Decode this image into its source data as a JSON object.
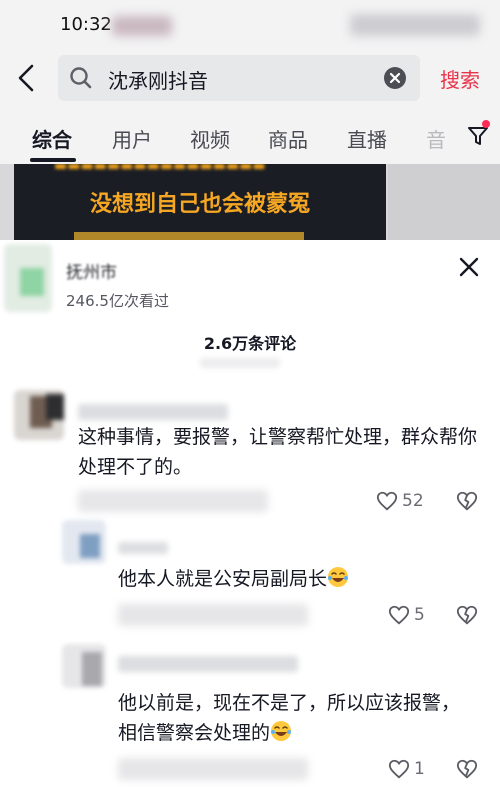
{
  "status_bar": {
    "time": "10:32"
  },
  "search": {
    "query": "沈承刚抖音",
    "submit_label": "搜索"
  },
  "tabs": [
    {
      "label": "综合",
      "active": true
    },
    {
      "label": "用户",
      "active": false
    },
    {
      "label": "视频",
      "active": false
    },
    {
      "label": "商品",
      "active": false
    },
    {
      "label": "直播",
      "active": false
    },
    {
      "label": "音",
      "active": false
    }
  ],
  "video": {
    "caption": "没想到自己也会被蒙冤"
  },
  "sheet": {
    "account_name": "抚州市",
    "views": "246.5亿次看过",
    "comment_count": "2.6万条评论"
  },
  "comments": [
    {
      "text": "这种事情，要报警，让警察帮忙处理，群众帮你处理不了的。",
      "likes": "52"
    },
    {
      "text": "他本人就是公安局副局长",
      "likes": "5",
      "emoji": "laughing-crying"
    },
    {
      "text": "他以前是，现在不是了，所以应该报警，相信警察会处理的",
      "likes": "1",
      "emoji": "laughing-crying"
    }
  ],
  "colors": {
    "accent_red": "#e8334a",
    "text_primary": "#161823",
    "text_secondary": "#6b6c73",
    "caption_orange": "#f5a623"
  },
  "icons": [
    "back-arrow-icon",
    "search-icon",
    "clear-icon",
    "filter-icon",
    "close-icon",
    "heart-icon",
    "broken-heart-icon",
    "laughing-crying-emoji-icon"
  ]
}
